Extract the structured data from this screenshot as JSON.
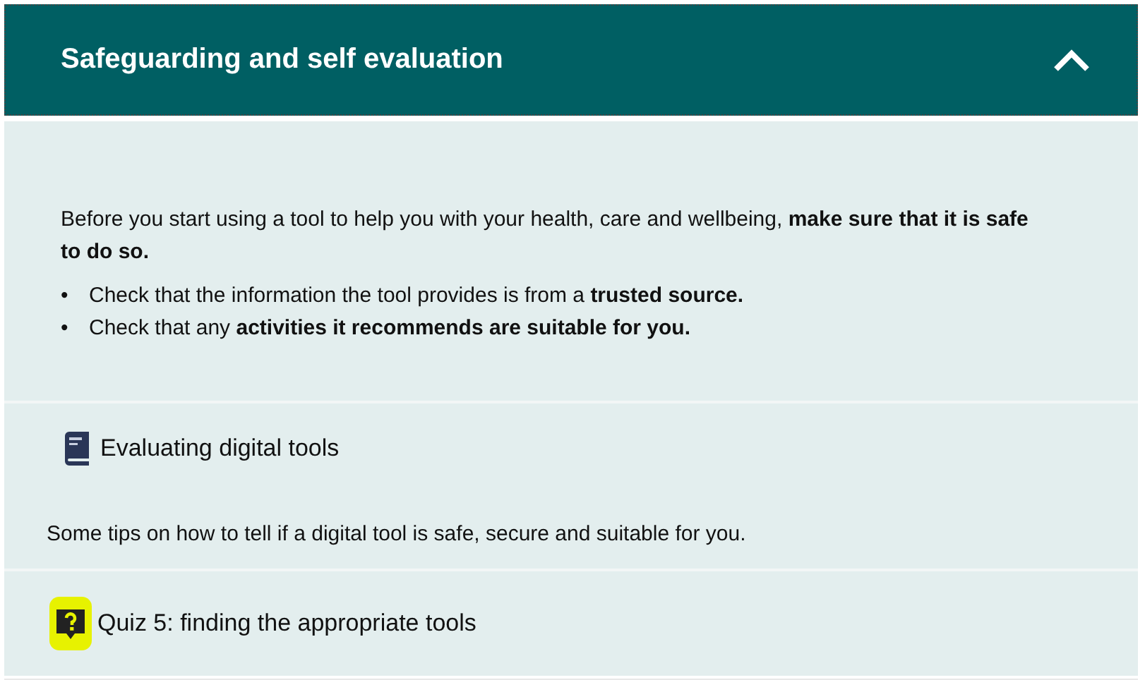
{
  "section": {
    "title": "Safeguarding and self evaluation",
    "expanded": true
  },
  "intro": {
    "paragraph": "Before you start using a tool to help you with your health, care and wellbeing, **make sure that it is safe to do so.**",
    "bullets": [
      {
        "marker": "•",
        "text": "Check that the information the tool provides is from a **trusted source.**"
      },
      {
        "marker": "•",
        "text": "Check that any **activities it recommends are suitable for you.**"
      }
    ]
  },
  "activities": [
    {
      "kind": "book",
      "title": "Evaluating digital tools",
      "description": "Some tips on how to tell if a digital tool is safe, secure and suitable for you.",
      "highlighted": false
    },
    {
      "kind": "quiz",
      "title": "Quiz 5: finding the appropriate tools",
      "highlighted": true
    }
  ]
}
